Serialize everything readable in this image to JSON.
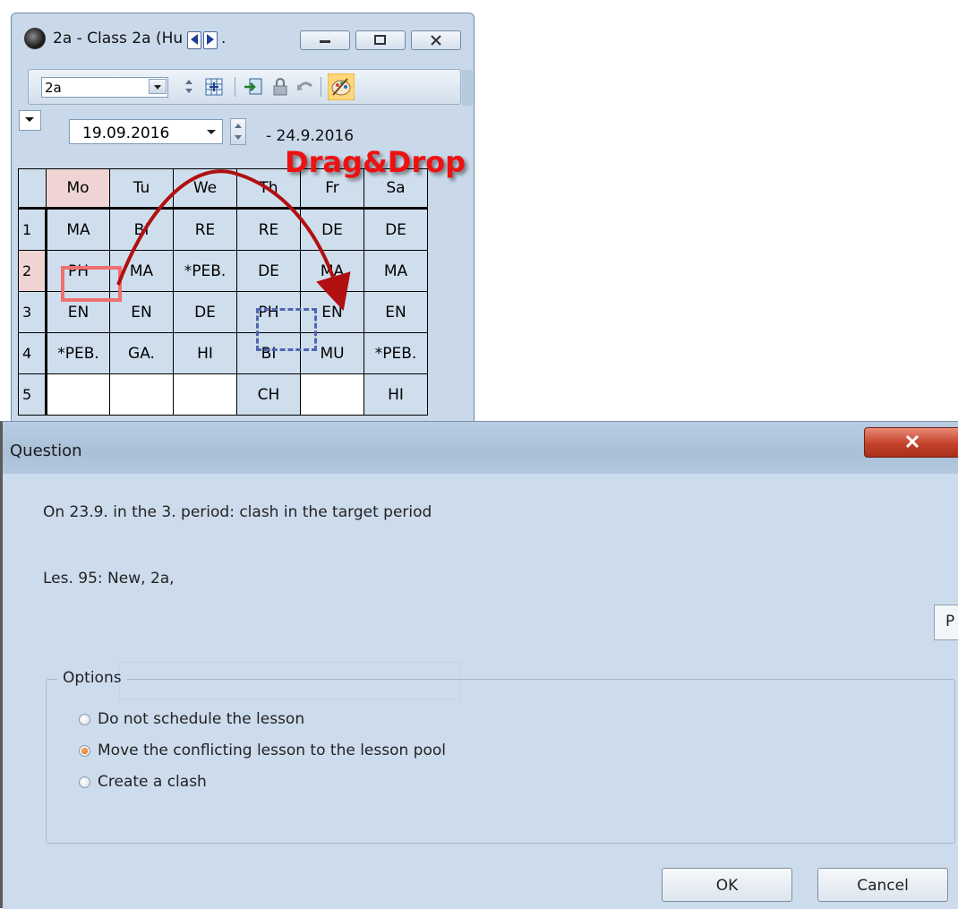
{
  "timetable_window": {
    "title": "2a - Class 2a (Hu",
    "title_suffix": ".",
    "toolbar": {
      "class_value": "2a"
    },
    "week_start": "19.09.2016",
    "week_end": "- 24.9.2016",
    "days": [
      "Mo",
      "Tu",
      "We",
      "Th",
      "Fr",
      "Sa"
    ],
    "periods": [
      {
        "num": "1",
        "cells": [
          "MA",
          "BI",
          "RE",
          "RE",
          "DE",
          "DE"
        ]
      },
      {
        "num": "2",
        "cells": [
          "PH",
          "MA",
          "*PEB.",
          "DE",
          "MA",
          "MA"
        ]
      },
      {
        "num": "3",
        "cells": [
          "EN",
          "EN",
          "DE",
          "PH",
          "EN",
          "EN"
        ]
      },
      {
        "num": "4",
        "cells": [
          "*PEB.",
          "GA.",
          "HI",
          "BI",
          "MU",
          "*PEB."
        ]
      },
      {
        "num": "5",
        "cells": [
          "",
          "",
          "",
          "CH",
          "",
          "HI"
        ]
      }
    ],
    "annotation": "Drag&Drop"
  },
  "dialog": {
    "title": "Question",
    "message_line1": "On  23.9. in the 3. period: clash in the target period",
    "message_line2": "Les. 95: New, 2a,",
    "side_button": "P",
    "options_legend": "Options",
    "options": [
      {
        "label": "Do not schedule the lesson",
        "checked": false
      },
      {
        "label": "Move the conflicting lesson to the lesson pool",
        "checked": true
      },
      {
        "label": "Create a clash",
        "checked": false
      }
    ],
    "ok_label": "OK",
    "cancel_label": "Cancel"
  },
  "colors": {
    "window_bg": "#c9d9ea",
    "dialog_bg": "#cddced",
    "highlight_day": "#f0d4d4",
    "annotation": "#ee1111",
    "close_button": "#c4412a"
  }
}
